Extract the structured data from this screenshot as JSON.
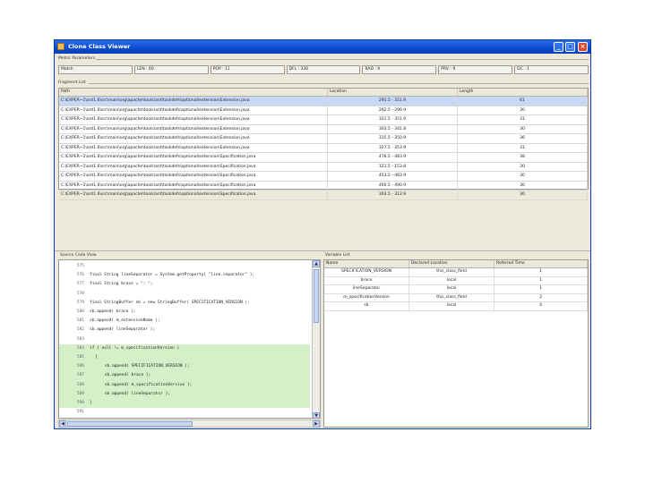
{
  "window": {
    "title": "Clone Class Viewer"
  },
  "metrics_group": {
    "label": "Metric Parameters"
  },
  "metrics": [
    "Match",
    "LEN : 60",
    "POP : 11",
    "DFL : 330",
    "RAD : 9",
    "PRV : 9",
    "DC : 1"
  ],
  "fragment_group": {
    "label": "Fragment List"
  },
  "file_table": {
    "headers": [
      "Path",
      "Location",
      "Length"
    ],
    "rows": [
      {
        "path": "C:\\EXPER~1\\ant1.6\\src\\main\\org\\apache\\tools\\ant\\taskdefs\\optional\\extension\\Extension.java",
        "location": "291.5 - 351.9",
        "length": "61"
      },
      {
        "path": "C:\\EXPER~1\\ant1.6\\src\\main\\org\\apache\\tools\\ant\\taskdefs\\optional\\extension\\Extension.java",
        "location": "262.5 - 290.9",
        "length": "30"
      },
      {
        "path": "C:\\EXPER~1\\ant1.6\\src\\main\\org\\apache\\tools\\ant\\taskdefs\\optional\\extension\\Extension.java",
        "location": "321.5 - 351.9",
        "length": "31"
      },
      {
        "path": "C:\\EXPER~1\\ant1.6\\src\\main\\org\\apache\\tools\\ant\\taskdefs\\optional\\extension\\Extension.java",
        "location": "303.5 - 341.8",
        "length": "30"
      },
      {
        "path": "C:\\EXPER~1\\ant1.6\\src\\main\\org\\apache\\tools\\ant\\taskdefs\\optional\\extension\\Extension.java",
        "location": "315.5 - 350.9",
        "length": "36"
      },
      {
        "path": "C:\\EXPER~1\\ant1.6\\src\\main\\org\\apache\\tools\\ant\\taskdefs\\optional\\extension\\Extension.java",
        "location": "327.5 - 353.9",
        "length": "31"
      },
      {
        "path": "C:\\EXPER~1\\ant1.6\\src\\main\\org\\apache\\tools\\ant\\taskdefs\\optional\\extension\\Specification.java",
        "location": "476.5 - 483.9",
        "length": "38"
      },
      {
        "path": "C:\\EXPER~1\\ant1.6\\src\\main\\org\\apache\\tools\\ant\\taskdefs\\optional\\extension\\Specification.java",
        "location": "121.5 - 153.8",
        "length": "30"
      },
      {
        "path": "C:\\EXPER~1\\ant1.6\\src\\main\\org\\apache\\tools\\ant\\taskdefs\\optional\\extension\\Specification.java",
        "location": "453.5 - 483.9",
        "length": "30"
      },
      {
        "path": "C:\\EXPER~1\\ant1.6\\src\\main\\org\\apache\\tools\\ant\\taskdefs\\optional\\extension\\Specification.java",
        "location": "460.5 - 490.9",
        "length": "30"
      },
      {
        "path": "C:\\EXPER~1\\ant1.6\\src\\main\\org\\apache\\tools\\ant\\taskdefs\\optional\\extension\\Specification.java",
        "location": "303.5 - 312.9",
        "length": "30"
      }
    ]
  },
  "source_pane": {
    "label": "Source Code View",
    "lines": [
      {
        "num": "575",
        "text": ""
      },
      {
        "num": "576",
        "text": "final String lineSeparator = System.getProperty( \"line.separator\" );"
      },
      {
        "num": "577",
        "text": "final String brace = \": \";"
      },
      {
        "num": "578",
        "text": ""
      },
      {
        "num": "579",
        "text": "final StringBuffer sb = new StringBuffer( SPECIFICATION_VERSION );"
      },
      {
        "num": "580",
        "text": "sb.append( brace );"
      },
      {
        "num": "581",
        "text": "sb.append( m_extensionName );"
      },
      {
        "num": "582",
        "text": "sb.append( lineSeparator );"
      },
      {
        "num": "583",
        "text": ""
      },
      {
        "num": "584",
        "text": "if ( null != m_specificationVersion )"
      },
      {
        "num": "585",
        "text": "{"
      },
      {
        "num": "586",
        "text": "    sb.append( SPECIFICATION_VERSION );"
      },
      {
        "num": "587",
        "text": "    sb.append( brace );"
      },
      {
        "num": "588",
        "text": "    sb.append( m_specificationVersion );"
      },
      {
        "num": "589",
        "text": "    sb.append( lineSeparator );"
      },
      {
        "num": "590",
        "text": "}"
      },
      {
        "num": "591",
        "text": ""
      }
    ]
  },
  "var_pane": {
    "label": "Variable List",
    "headers": [
      "Name",
      "Declared Location",
      "Referred Time"
    ],
    "rows": [
      {
        "name": "SPECIFICATION_VERSION",
        "location": "this_class_field",
        "time": "1"
      },
      {
        "name": "brace",
        "location": "local",
        "time": "1"
      },
      {
        "name": "lineSeparator",
        "location": "local",
        "time": "1"
      },
      {
        "name": "m_specificationVersion",
        "location": "this_class_field",
        "time": "2"
      },
      {
        "name": "sb",
        "location": "local",
        "time": "4"
      }
    ]
  },
  "icons": {
    "minimize": "minimize-icon",
    "maximize": "maximize-icon",
    "close": "close-icon"
  }
}
